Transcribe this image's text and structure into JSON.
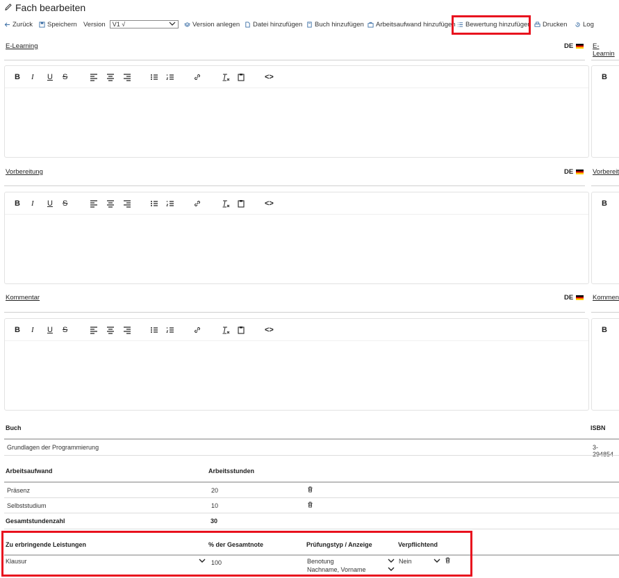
{
  "page": {
    "title": "Fach bearbeiten"
  },
  "toolbar": {
    "back": "Zurück",
    "save": "Speichern",
    "version_label": "Version",
    "version_value": "V1 √",
    "create_version": "Version anlegen",
    "add_file": "Datei hinzufügen",
    "add_book": "Buch hinzufügen",
    "add_workload": "Arbeitsaufwand hinzufügen",
    "add_assessment": "Bewertung hinzufügen",
    "print": "Drucken",
    "log": "Log"
  },
  "sections": [
    {
      "label": "E-Learning",
      "lang": "DE",
      "side_label": "E-Learnin",
      "side_toolbar": "B"
    },
    {
      "label": "Vorbereitung",
      "lang": "DE",
      "side_label": "Vorbereit",
      "side_toolbar": "B"
    },
    {
      "label": "Kommentar",
      "lang": "DE",
      "side_label": "Kommen",
      "side_toolbar": "B"
    }
  ],
  "editor_toolbar": {
    "bold": "B",
    "italic": "I",
    "underline": "U",
    "strike": "S",
    "code": "<>"
  },
  "book": {
    "header": "Buch",
    "isbn_header": "ISBN",
    "title": "Grundlagen der Programmierung",
    "isbn": "3-294854"
  },
  "workload": {
    "header": "Arbeitsaufwand",
    "hours_header": "Arbeitsstunden",
    "rows": [
      {
        "name": "Präsenz",
        "hours": "20"
      },
      {
        "name": "Selbststudium",
        "hours": "10"
      }
    ],
    "total_label": "Gesamtstundenzahl",
    "total_value": "30"
  },
  "assessment": {
    "col_performance": "Zu erbringende Leistungen",
    "col_percent": "% der Gesamtnote",
    "col_exam_type": "Prüfungstyp / Anzeige",
    "col_mandatory": "Verpflichtend",
    "row": {
      "performance": "Klausur",
      "percent": "100",
      "exam_type": "Benotung",
      "display": "Nachname, Vorname",
      "mandatory": "Nein"
    }
  },
  "colors": {
    "highlight": "#e8111e",
    "accent": "#3a6ea5"
  }
}
